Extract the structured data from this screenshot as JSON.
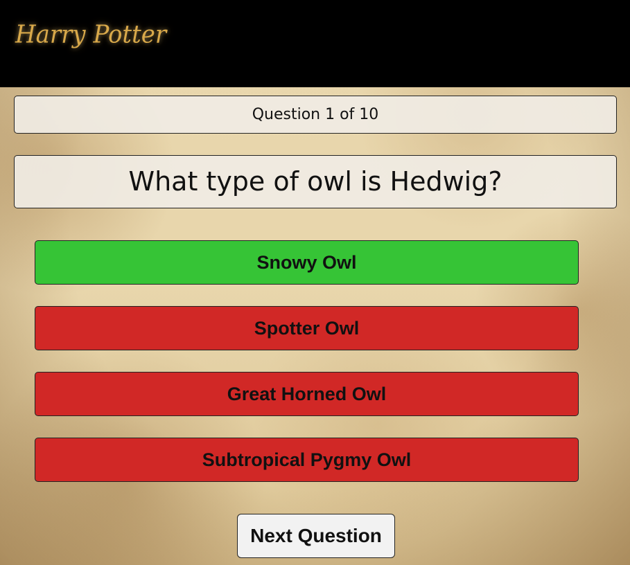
{
  "header": {
    "logo_text": "Harry Potter"
  },
  "quiz": {
    "counter": "Question 1 of 10",
    "question": "What type of owl is Hedwig?",
    "answers": [
      {
        "label": "Snowy Owl",
        "state": "correct"
      },
      {
        "label": "Spotter Owl",
        "state": "wrong"
      },
      {
        "label": "Great Horned Owl",
        "state": "wrong"
      },
      {
        "label": "Subtropical Pygmy Owl",
        "state": "wrong"
      }
    ],
    "next_label": "Next Question"
  },
  "colors": {
    "correct": "#36c436",
    "wrong": "#d12826",
    "header_bg": "#000000",
    "logo_gold": "#d9a94a"
  }
}
